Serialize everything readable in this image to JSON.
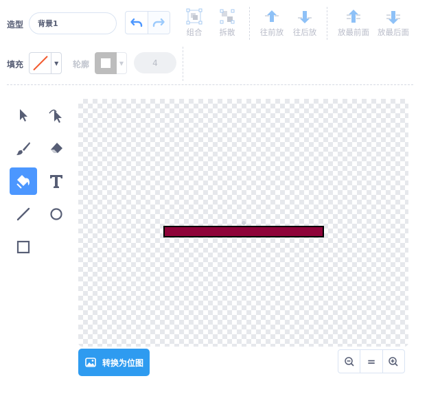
{
  "costume": {
    "label": "造型",
    "name_value": "背景1",
    "name_placeholder": ""
  },
  "toolbar": {
    "undo_icon": "undo-icon",
    "redo_icon": "redo-icon",
    "group_label": "组合",
    "ungroup_label": "拆散",
    "forward_label": "往前放",
    "backward_label": "往后放",
    "front_label": "放最前面",
    "back_label": "放最后面"
  },
  "fill": {
    "label": "填充",
    "state": "none"
  },
  "outline": {
    "label": "轮廓",
    "width_value": "4"
  },
  "tools": [
    {
      "name": "select",
      "icon": "arrow-icon"
    },
    {
      "name": "reshape",
      "icon": "reshape-icon"
    },
    {
      "name": "brush",
      "icon": "brush-icon"
    },
    {
      "name": "eraser",
      "icon": "eraser-icon"
    },
    {
      "name": "fill",
      "icon": "paint-bucket-icon",
      "active": true
    },
    {
      "name": "text",
      "icon": "text-icon"
    },
    {
      "name": "line",
      "icon": "line-icon"
    },
    {
      "name": "circle",
      "icon": "circle-icon"
    },
    {
      "name": "rectangle",
      "icon": "rectangle-icon"
    }
  ],
  "canvas": {
    "shape_fill": "#8e0339",
    "shape_stroke": "#000000"
  },
  "convert": {
    "label": "转换为位图"
  },
  "zoom": {
    "zoom_out_icon": "zoom-out-icon",
    "reset_label": "=",
    "zoom_in_icon": "zoom-in-icon"
  },
  "colors": {
    "accent": "#4c97ff",
    "button_blue": "#2e9bf0",
    "text": "#575e75",
    "disabled": "#b9bcc9"
  }
}
